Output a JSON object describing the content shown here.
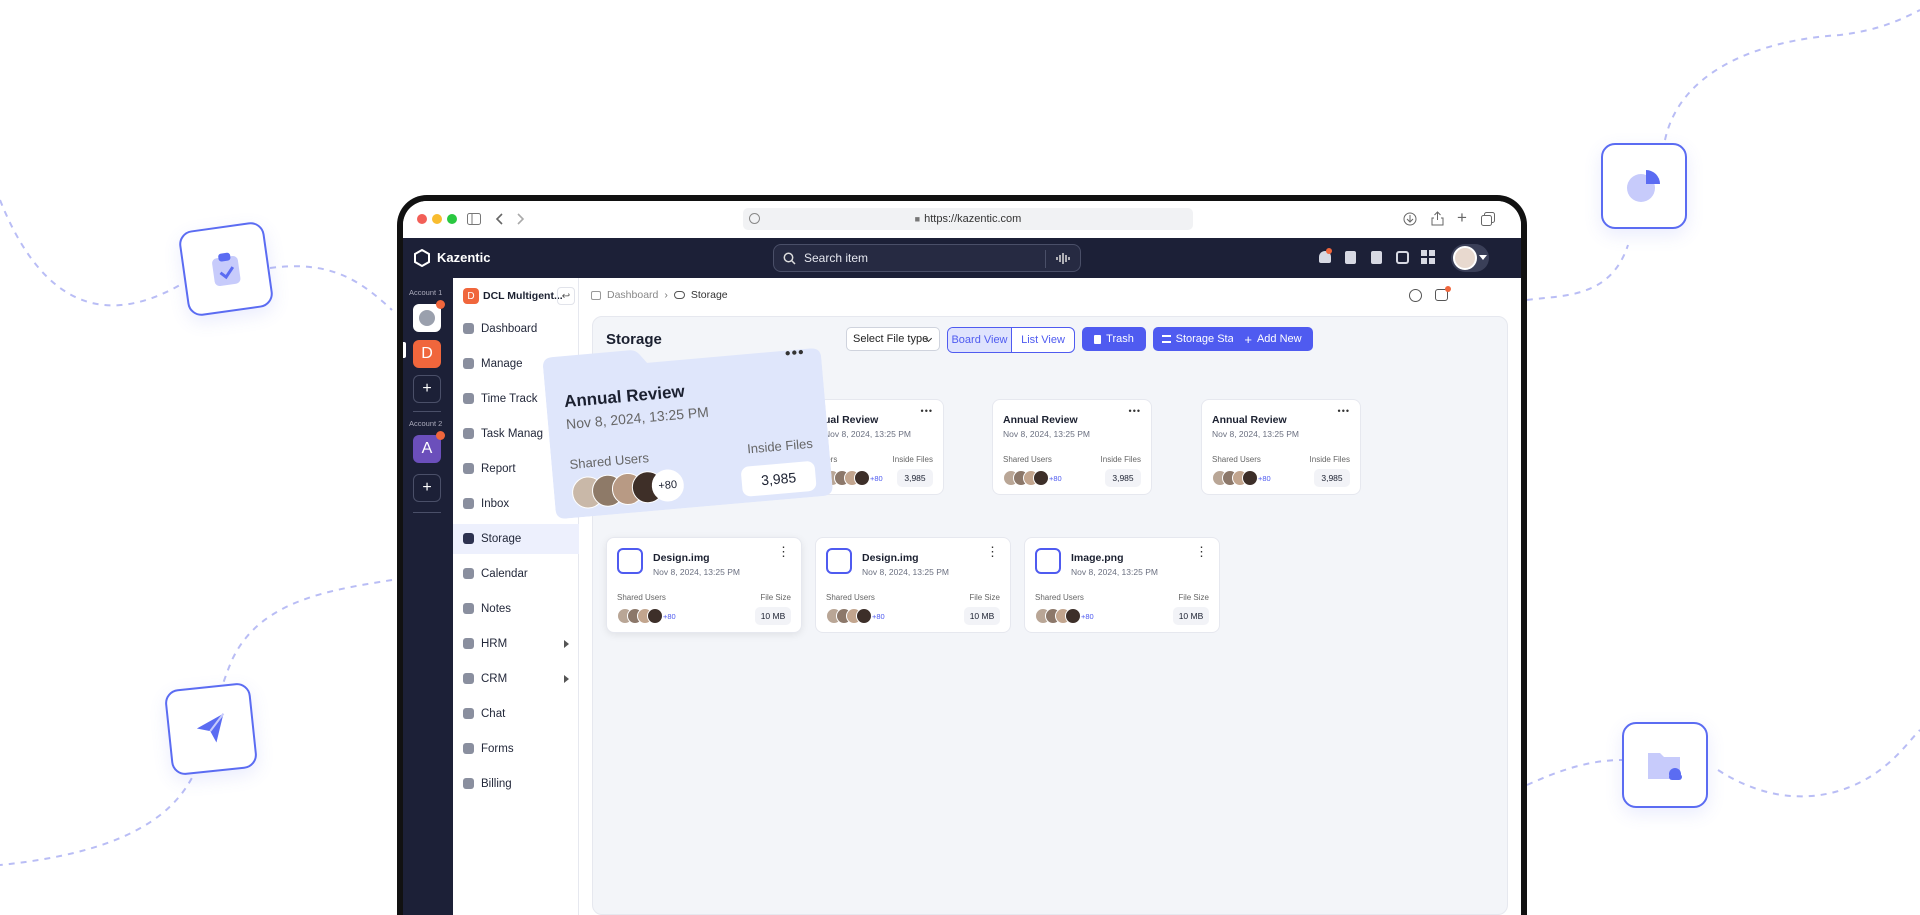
{
  "browser": {
    "url": "https://kazentic.com"
  },
  "app": {
    "brand": "Kazentic",
    "search_placeholder": "Search item"
  },
  "rail": {
    "account1_label": "Account 1",
    "account2_label": "Account 2",
    "d_letter": "D",
    "a_letter": "A",
    "plus": "+"
  },
  "workspace": {
    "letter": "D",
    "name": "DCL Multigent..."
  },
  "sidebar": {
    "items": [
      {
        "label": "Dashboard",
        "icon": "home-icon"
      },
      {
        "label": "Manage",
        "icon": "puzzle-icon"
      },
      {
        "label": "Time Track",
        "icon": "clock-icon"
      },
      {
        "label": "Task Manag",
        "icon": "clipboard-icon"
      },
      {
        "label": "Report",
        "icon": "chart-icon"
      },
      {
        "label": "Inbox",
        "icon": "mail-icon"
      },
      {
        "label": "Storage",
        "icon": "cloud-icon"
      },
      {
        "label": "Calendar",
        "icon": "calendar-icon"
      },
      {
        "label": "Notes",
        "icon": "note-icon"
      },
      {
        "label": "HRM",
        "icon": "badge-icon"
      },
      {
        "label": "CRM",
        "icon": "user-circle-icon"
      },
      {
        "label": "Chat",
        "icon": "chat-icon"
      },
      {
        "label": "Forms",
        "icon": "form-icon"
      },
      {
        "label": "Billing",
        "icon": "billing-icon"
      }
    ]
  },
  "breadcrumb": {
    "home": "Dashboard",
    "current": "Storage"
  },
  "storage": {
    "title": "Storage",
    "file_type_select": "Select File type",
    "board_view": "Board View",
    "list_view": "List View",
    "trash": "Trash",
    "storage_status": "Storage Status",
    "add_new": "Add New"
  },
  "folders": [
    {
      "title": "ual Review",
      "date": "Nov 8, 2024, 13:25 PM",
      "users_label": "ters",
      "files_label": "Inside Files",
      "count": "3,985",
      "extra": "+80"
    },
    {
      "title": "Annual Review",
      "date": "Nov 8, 2024, 13:25 PM",
      "users_label": "Shared Users",
      "files_label": "Inside Files",
      "count": "3,985",
      "extra": "+80"
    },
    {
      "title": "Annual Review",
      "date": "Nov 8, 2024, 13:25 PM",
      "users_label": "Shared Users",
      "files_label": "Inside Files",
      "count": "3,985",
      "extra": "+80"
    }
  ],
  "files": [
    {
      "title": "Design.img",
      "date": "Nov 8, 2024, 13:25 PM",
      "users_label": "Shared Users",
      "size_label": "File Size",
      "size": "10 MB",
      "extra": "+80"
    },
    {
      "title": "Design.img",
      "date": "Nov 8, 2024, 13:25 PM",
      "users_label": "Shared Users",
      "size_label": "File Size",
      "size": "10 MB",
      "extra": "+80"
    },
    {
      "title": "Image.png",
      "date": "Nov 8, 2024, 13:25 PM",
      "users_label": "Shared Users",
      "size_label": "File Size",
      "size": "10 MB",
      "extra": "+80"
    }
  ],
  "drag_card": {
    "title": "Annual Review",
    "date": "Nov 8, 2024, 13:25 PM",
    "users_label": "Shared Users",
    "files_label": "Inside Files",
    "count": "3,985",
    "extra": "+80"
  },
  "colors": {
    "accent": "#4f5bf0",
    "dark": "#1c2037",
    "orange": "#f0663c",
    "purple": "#6b4fbb"
  }
}
